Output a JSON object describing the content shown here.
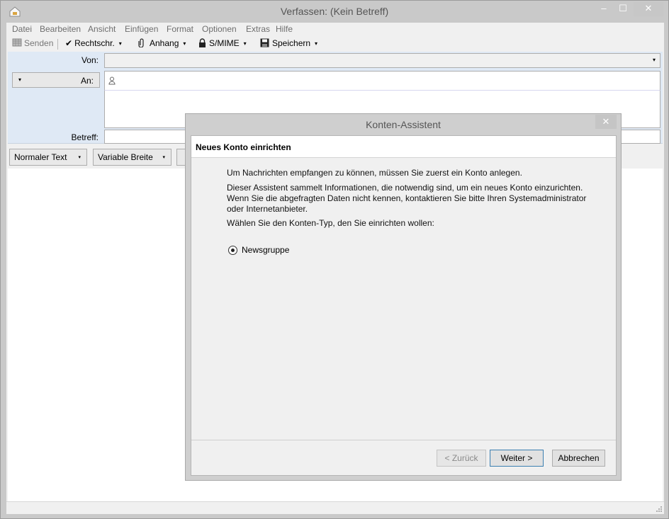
{
  "window": {
    "title": "Verfassen: (Kein Betreff)",
    "min_symbol": "–",
    "max_symbol": "☐",
    "close_symbol": "✕"
  },
  "menu": [
    "Datei",
    "Bearbeiten",
    "Ansicht",
    "Einfügen",
    "Format",
    "Optionen",
    "Extras",
    "Hilfe"
  ],
  "toolbar": {
    "send": "Senden",
    "spell": "Rechtschr.",
    "attach": "Anhang",
    "smime": "S/MIME",
    "save": "Speichern",
    "dropdown_symbol": "▾"
  },
  "header": {
    "from_label": "Von:",
    "to_label": "An:",
    "subject_label": "Betreff:",
    "arrow_symbol": "▾"
  },
  "format_bar": {
    "paragraph": "Normaler Text",
    "font": "Variable Breite"
  },
  "dialog": {
    "title": "Konten-Assistent",
    "close_symbol": "✕",
    "heading": "Neues Konto einrichten",
    "para1": "Um Nachrichten empfangen zu können, müssen Sie zuerst ein Konto anlegen.",
    "para2_line1": "Dieser Assistent sammelt Informationen, die notwendig sind, um ein neues Konto einzurichten.",
    "para2_line2": "Wenn Sie die abgefragten Daten nicht kennen, kontaktieren Sie bitte Ihren Systemadministrator",
    "para2_line3": "oder Internetanbieter.",
    "para3": "Wählen Sie den Konten-Typ, den Sie einrichten wollen:",
    "account_type": "Newsgruppe",
    "account_type_selected": true,
    "back": "< Zurück",
    "next": "Weiter >",
    "cancel": "Abbrechen"
  }
}
